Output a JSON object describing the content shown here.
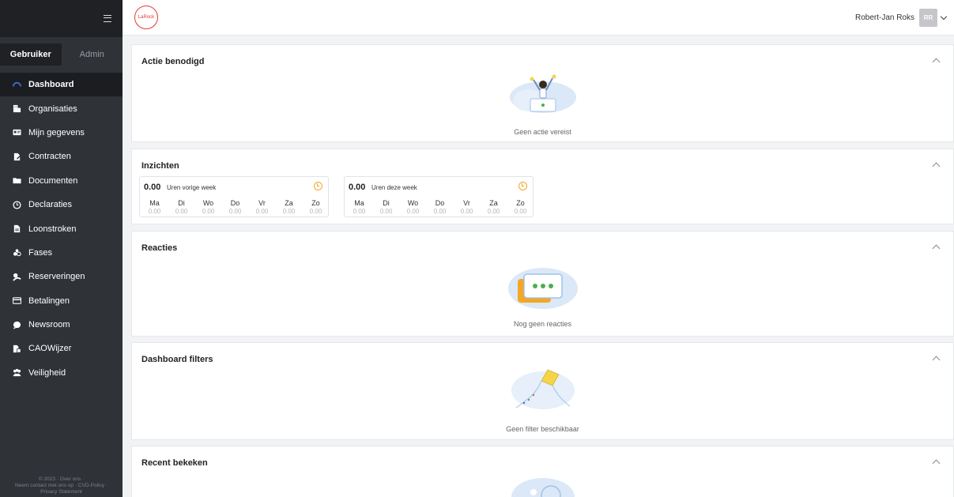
{
  "sidebar": {
    "tabs": [
      "Gebruiker",
      "Admin"
    ],
    "items": [
      {
        "label": "Dashboard",
        "icon": "dashboard-icon"
      },
      {
        "label": "Organisaties",
        "icon": "building-icon"
      },
      {
        "label": "Mijn gegevens",
        "icon": "id-card-icon"
      },
      {
        "label": "Contracten",
        "icon": "contract-icon"
      },
      {
        "label": "Documenten",
        "icon": "folder-icon"
      },
      {
        "label": "Declaraties",
        "icon": "clock-icon"
      },
      {
        "label": "Loonstroken",
        "icon": "file-icon"
      },
      {
        "label": "Fases",
        "icon": "phases-icon"
      },
      {
        "label": "Reserveringen",
        "icon": "reservation-icon"
      },
      {
        "label": "Betalingen",
        "icon": "credit-card-icon"
      },
      {
        "label": "Newsroom",
        "icon": "chat-icon"
      },
      {
        "label": "CAOWijzer",
        "icon": "cao-icon"
      },
      {
        "label": "Veiligheid",
        "icon": "safety-icon"
      }
    ],
    "footer": {
      "line1": "© 2023 · Over ons ·",
      "line2": "Neem contact met ons op · CVD-Policy ·",
      "line3": "Privacy Statement"
    }
  },
  "topbar": {
    "logo_text": "LaRock",
    "user_name": "Robert-Jan Roks",
    "avatar_initials": "RR"
  },
  "panels": {
    "actie": {
      "title": "Actie benodigd",
      "message": "Geen actie vereist"
    },
    "inzichten": {
      "title": "Inzichten",
      "cards": [
        {
          "total": "0.00",
          "label": "Uren vorige week"
        },
        {
          "total": "0.00",
          "label": "Uren deze week"
        }
      ],
      "days": [
        "Ma",
        "Di",
        "Wo",
        "Do",
        "Vr",
        "Za",
        "Zo"
      ],
      "day_values": [
        "0.00",
        "0.00",
        "0.00",
        "0.00",
        "0.00",
        "0.00",
        "0.00"
      ]
    },
    "reacties": {
      "title": "Reacties",
      "message": "Nog geen reacties"
    },
    "filters": {
      "title": "Dashboard filters",
      "message": "Geen filter beschikbaar"
    },
    "recent": {
      "title": "Recent bekeken"
    }
  },
  "colors": {
    "sidebar_bg": "#2f3237",
    "sidebar_active": "#1b1d20",
    "accent_orange": "#f5a623",
    "logo_red": "#e53935",
    "dots_green": "#4caf50"
  }
}
